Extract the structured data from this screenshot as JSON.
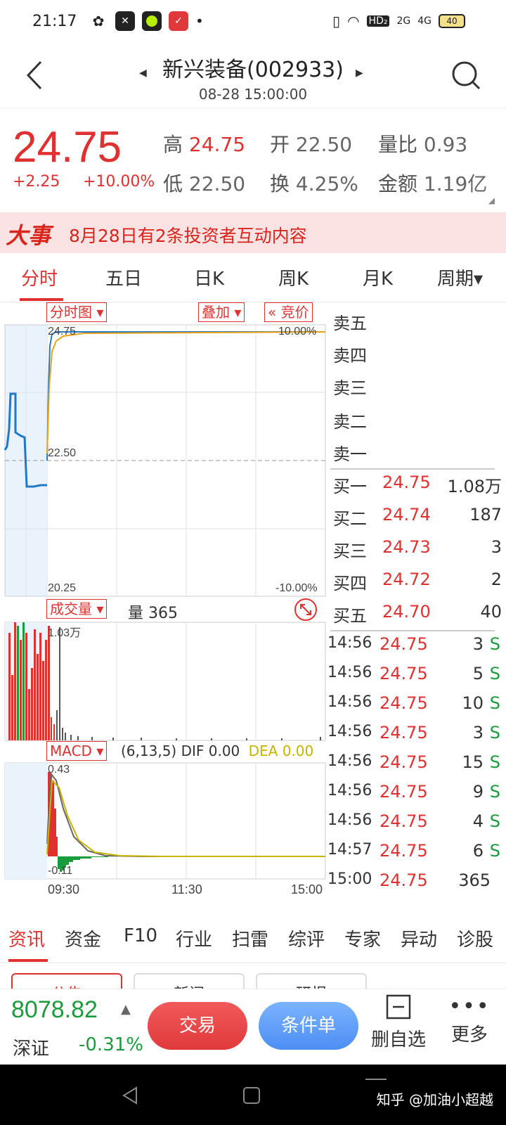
{
  "status_bar": {
    "time": "21:17",
    "battery": "40",
    "net1": "HD₂",
    "net2": "2G",
    "net3": "4G"
  },
  "header": {
    "title": "新兴装备(002933)",
    "datetime": "08-28 15:00:00"
  },
  "quote": {
    "price": "24.75",
    "change": "+2.25",
    "change_pct": "+10.00%",
    "high_label": "高",
    "high": "24.75",
    "open_label": "开",
    "open": "22.50",
    "vol_ratio_label": "量比",
    "vol_ratio": "0.93",
    "low_label": "低",
    "low": "22.50",
    "turnover_label": "换",
    "turnover": "4.25%",
    "amount_label": "金额",
    "amount": "1.19亿"
  },
  "banner": {
    "tag": "大事",
    "text": "8月28日有2条投资者互动内容"
  },
  "tabs": [
    {
      "label": "分时"
    },
    {
      "label": "五日"
    },
    {
      "label": "日K"
    },
    {
      "label": "周K"
    },
    {
      "label": "月K"
    },
    {
      "label": "周期▾"
    }
  ],
  "chart": {
    "intraday_btn": "分时图 ▾",
    "overlay_btn": "叠加 ▾",
    "auction_btn": "« 竞价",
    "price_max": "24.75",
    "price_mid": "22.50",
    "price_min": "20.25",
    "pct_max": "10.00%",
    "pct_min": "-10.00%",
    "volume_btn": "成交量 ▾",
    "volume_label": "量 365",
    "volume_max": "1.03万",
    "macd_btn": "MACD ▾",
    "macd_params": "(6,13,5)",
    "dif_label": "DIF",
    "dif": "0.00",
    "dea_label": "DEA",
    "dea": "0.00",
    "macd_max": "0.43",
    "macd_min": "-0.11",
    "time_start": "09:30",
    "time_mid": "11:30",
    "time_end": "15:00"
  },
  "chart_data": {
    "type": "line",
    "series": [],
    "ylim": [
      20.25,
      24.75
    ],
    "x_ticks": [
      "09:30",
      "11:30",
      "15:00"
    ]
  },
  "order_book": {
    "asks": [
      {
        "label": "卖五",
        "price": "",
        "vol": ""
      },
      {
        "label": "卖四",
        "price": "",
        "vol": ""
      },
      {
        "label": "卖三",
        "price": "",
        "vol": ""
      },
      {
        "label": "卖二",
        "price": "",
        "vol": ""
      },
      {
        "label": "卖一",
        "price": "",
        "vol": ""
      }
    ],
    "bids": [
      {
        "label": "买一",
        "price": "24.75",
        "vol": "1.08万"
      },
      {
        "label": "买二",
        "price": "24.74",
        "vol": "187"
      },
      {
        "label": "买三",
        "price": "24.73",
        "vol": "3"
      },
      {
        "label": "买四",
        "price": "24.72",
        "vol": "2"
      },
      {
        "label": "买五",
        "price": "24.70",
        "vol": "40"
      }
    ],
    "trades": [
      {
        "time": "14:56",
        "price": "24.75",
        "vol": "3",
        "side": "S"
      },
      {
        "time": "14:56",
        "price": "24.75",
        "vol": "5",
        "side": "S"
      },
      {
        "time": "14:56",
        "price": "24.75",
        "vol": "10",
        "side": "S"
      },
      {
        "time": "14:56",
        "price": "24.75",
        "vol": "3",
        "side": "S"
      },
      {
        "time": "14:56",
        "price": "24.75",
        "vol": "15",
        "side": "S"
      },
      {
        "time": "14:56",
        "price": "24.75",
        "vol": "9",
        "side": "S"
      },
      {
        "time": "14:56",
        "price": "24.75",
        "vol": "4",
        "side": "S"
      },
      {
        "time": "14:57",
        "price": "24.75",
        "vol": "6",
        "side": "S"
      },
      {
        "time": "15:00",
        "price": "24.75",
        "vol": "365",
        "side": ""
      }
    ]
  },
  "sub_tabs": [
    {
      "label": "资讯"
    },
    {
      "label": "资金"
    },
    {
      "label": "F10"
    },
    {
      "label": "行业"
    },
    {
      "label": "扫雷"
    },
    {
      "label": "综评"
    },
    {
      "label": "专家"
    },
    {
      "label": "异动"
    },
    {
      "label": "诊股"
    }
  ],
  "pills": [
    {
      "label": "公告"
    },
    {
      "label": "新闻"
    },
    {
      "label": "研报"
    }
  ],
  "footer": {
    "index_value": "8078.82",
    "index_name": "深证",
    "index_pct": "-0.31%",
    "trade_btn": "交易",
    "cond_btn": "条件单",
    "del_watch": "删自选",
    "more": "更多"
  },
  "watermark": "知乎 @加油小超越",
  "colors": {
    "up": "#e03131",
    "down": "#1a9c3c",
    "price_line": "#1f78c8",
    "avg_line": "#e8a317"
  }
}
